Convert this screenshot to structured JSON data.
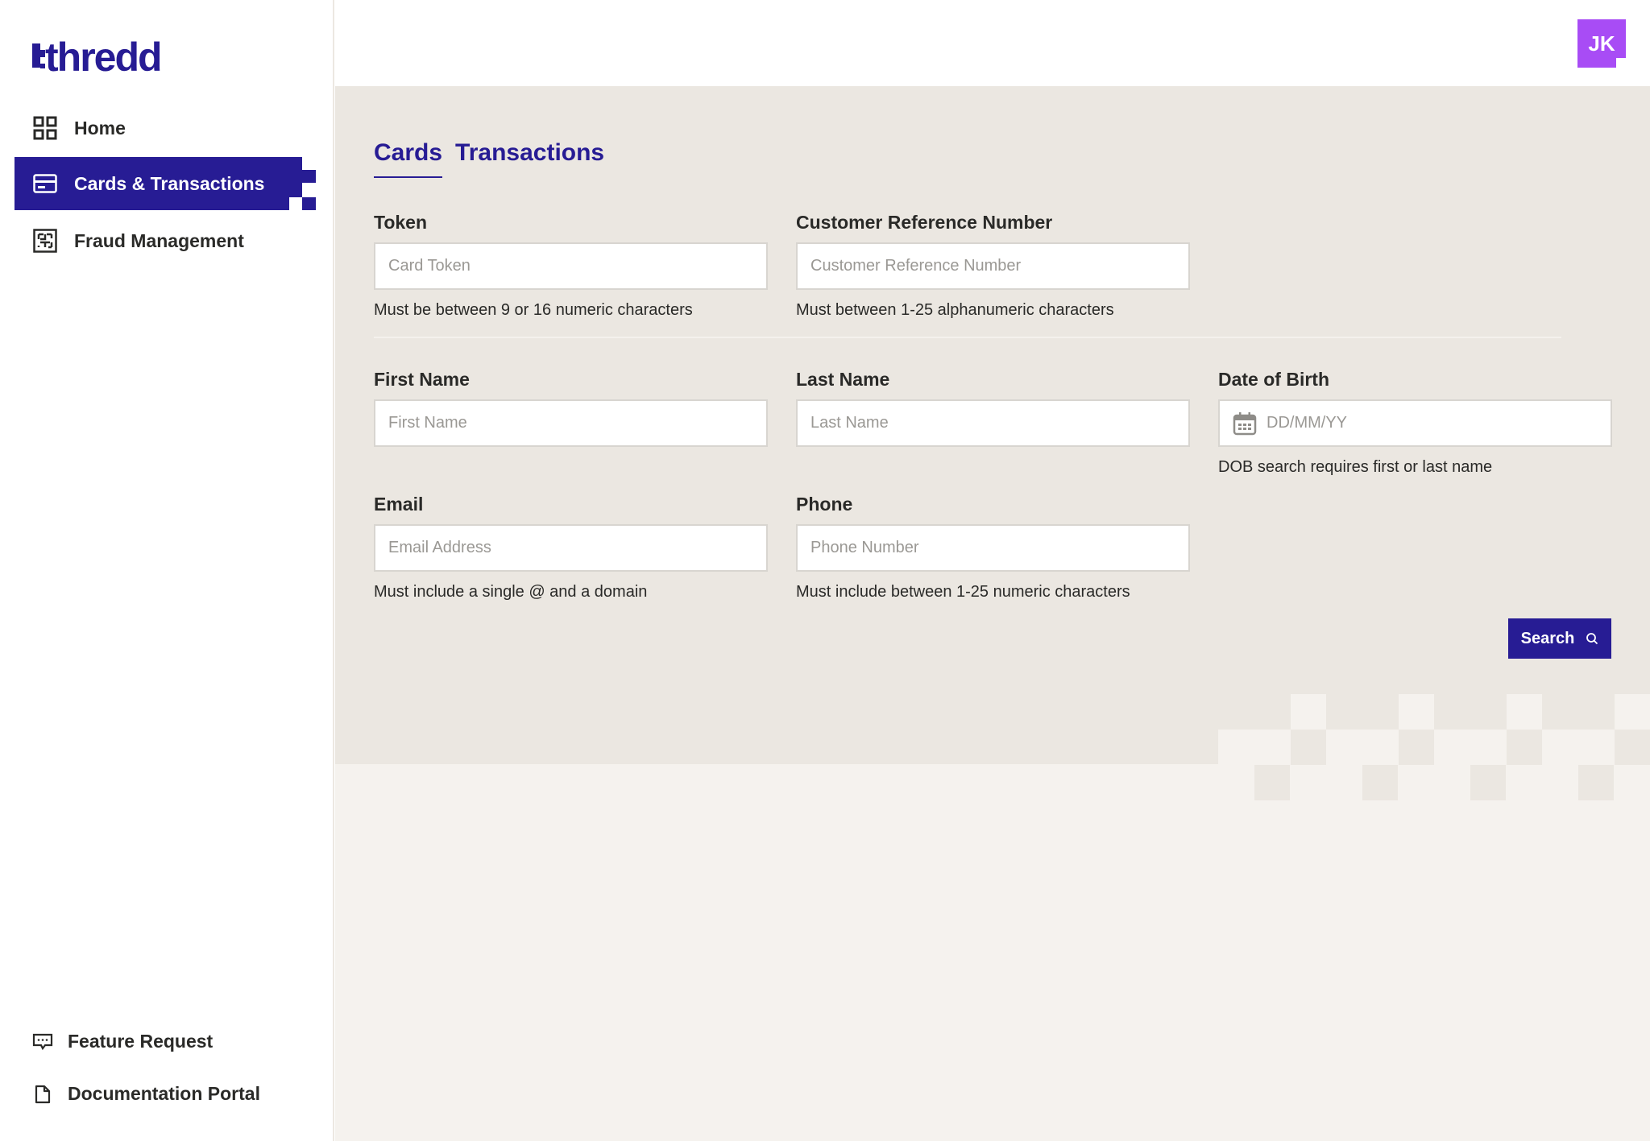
{
  "brand": {
    "logo_text": "thredd",
    "color": "#271c94"
  },
  "user": {
    "initials": "JK",
    "avatar_color": "#a84cf5"
  },
  "sidebar": {
    "items": [
      {
        "label": "Home",
        "icon": "grid-icon",
        "active": false
      },
      {
        "label": "Cards & Transactions",
        "icon": "card-icon",
        "active": true
      },
      {
        "label": "Fraud Management",
        "icon": "maze-icon",
        "active": false
      }
    ],
    "bottom_items": [
      {
        "label": "Feature Request",
        "icon": "chat-bubble-icon"
      },
      {
        "label": "Documentation Portal",
        "icon": "document-icon"
      }
    ]
  },
  "tabs": [
    {
      "label": "Cards",
      "active": true
    },
    {
      "label": "Transactions",
      "active": false
    }
  ],
  "form": {
    "token": {
      "label": "Token",
      "placeholder": "Card Token",
      "value": "",
      "hint": "Must be between 9 or 16 numeric characters"
    },
    "crn": {
      "label": "Customer Reference Number",
      "placeholder": "Customer Reference Number",
      "value": "",
      "hint": "Must between 1-25 alphanumeric characters"
    },
    "first_name": {
      "label": "First Name",
      "placeholder": "First Name",
      "value": ""
    },
    "last_name": {
      "label": "Last Name",
      "placeholder": "Last Name",
      "value": ""
    },
    "dob": {
      "label": "Date of Birth",
      "placeholder": "DD/MM/YY",
      "value": "",
      "hint": "DOB search requires first or last name",
      "icon": "calendar-icon"
    },
    "email": {
      "label": "Email",
      "placeholder": "Email Address",
      "value": "",
      "hint": "Must include a single @ and a domain"
    },
    "phone": {
      "label": "Phone",
      "placeholder": "Phone Number",
      "value": "",
      "hint": "Must include between 1-25 numeric characters"
    }
  },
  "search_button": {
    "label": "Search",
    "icon": "search-icon"
  }
}
